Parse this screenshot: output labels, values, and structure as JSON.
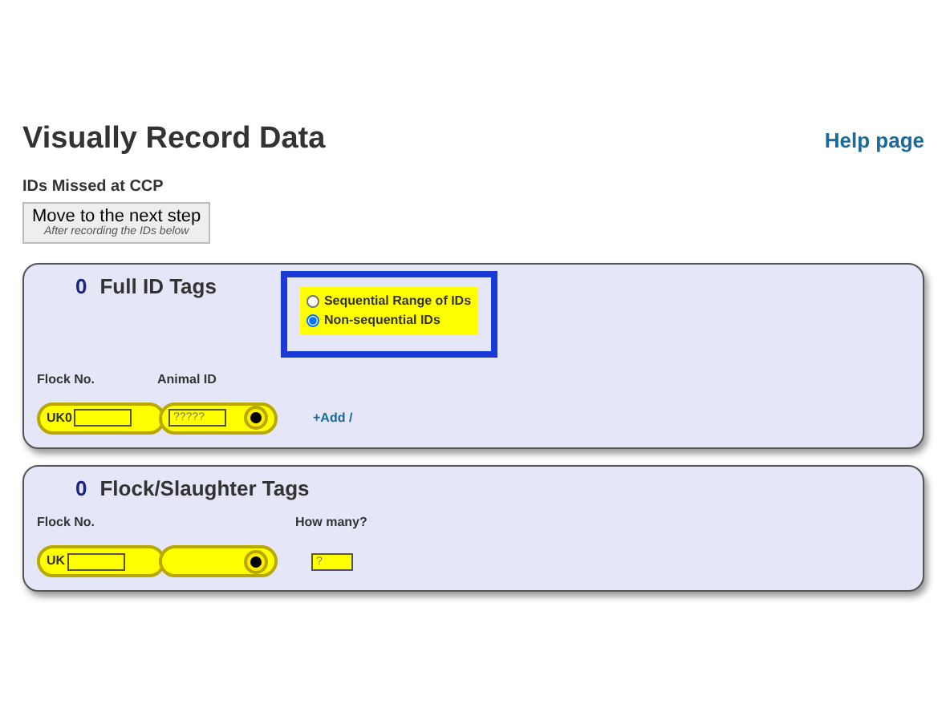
{
  "page": {
    "title": "Visually Record Data",
    "help_link": "Help page"
  },
  "section_label": "IDs Missed at CCP",
  "next_button": {
    "label": "Move to the next step",
    "sublabel": "After recording the IDs below"
  },
  "panels": [
    {
      "kind": "full",
      "count": "0",
      "title": "Full ID Tags",
      "options": [
        {
          "label": "Sequential Range of IDs",
          "selected": false
        },
        {
          "label": "Non-sequential IDs",
          "selected": true
        }
      ],
      "labels": [
        "Flock No.",
        "Animal ID"
      ],
      "prefix": "UK0",
      "animal_placeholder": "?????",
      "add_link": "+Add /"
    },
    {
      "kind": "flock",
      "count": "0",
      "title": "Flock/Slaughter Tags",
      "labels": [
        "Flock No.",
        "How many?"
      ],
      "prefix": "UK",
      "quantity_placeholder": "?"
    }
  ]
}
